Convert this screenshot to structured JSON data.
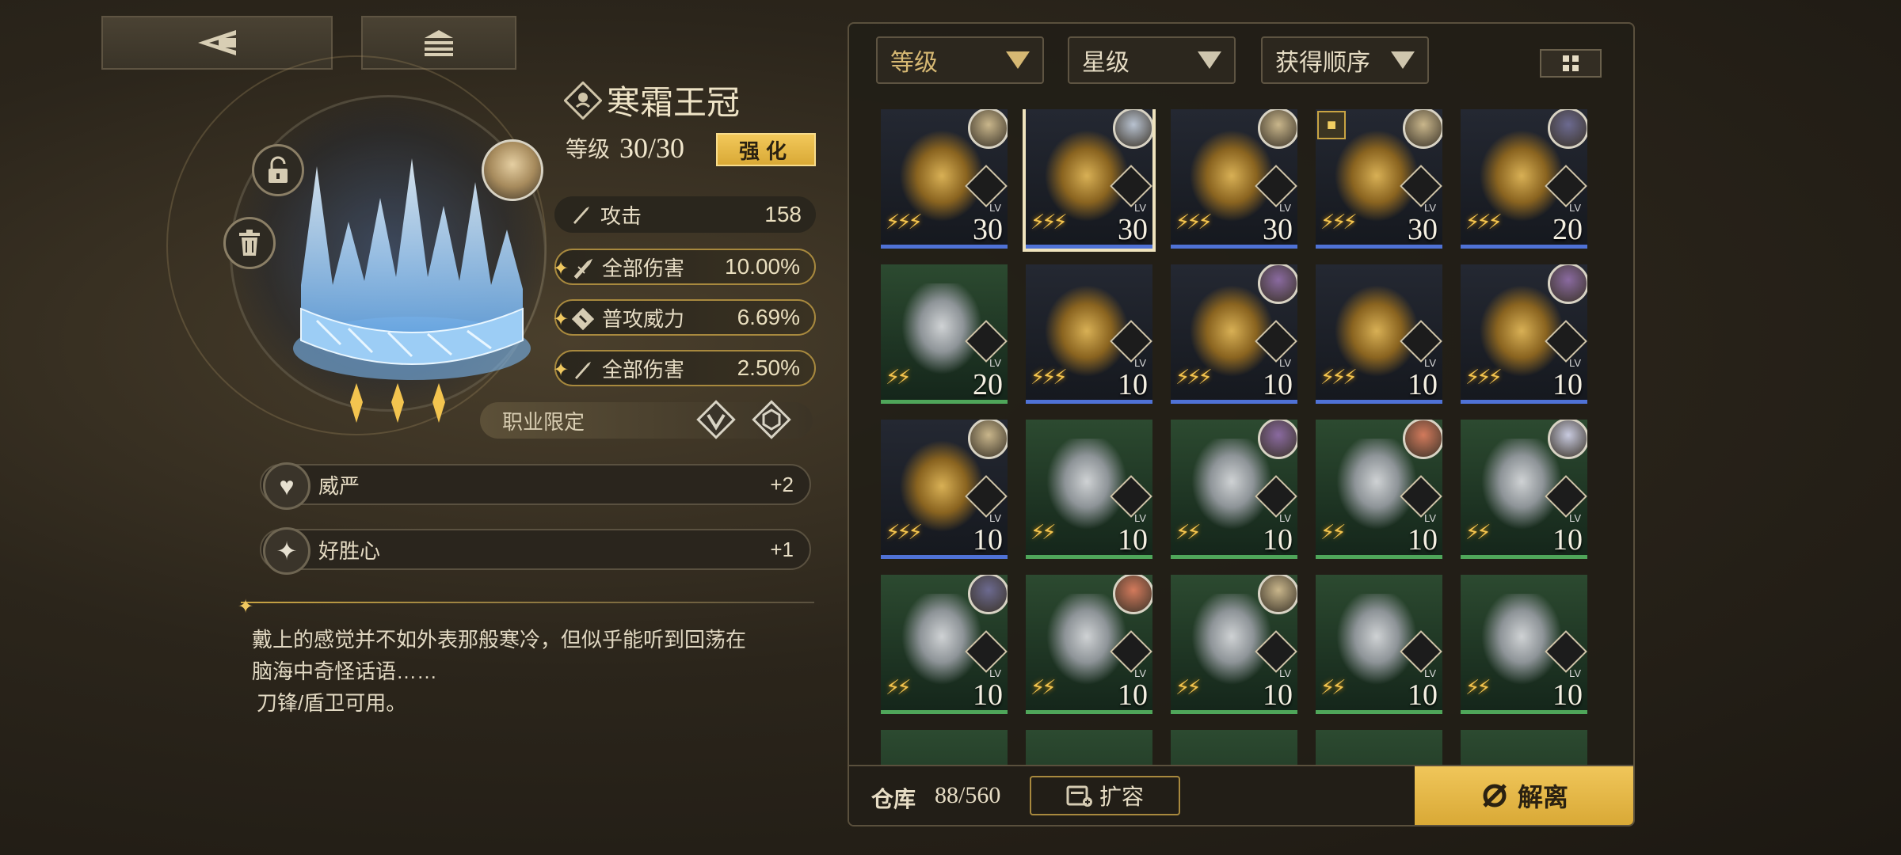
{
  "nav": {
    "back_icon": "back-triangle-icon",
    "home_icon": "home-stack-icon"
  },
  "item": {
    "name": "寒霜王冠",
    "level_label": "等级",
    "level_value": "30/30",
    "enhance_label": "强化",
    "main_stat": {
      "label": "攻击",
      "value": "158"
    },
    "sub_stats": [
      {
        "label": "全部伤害",
        "value": "10.00%"
      },
      {
        "label": "普攻威力",
        "value": "6.69%"
      },
      {
        "label": "全部伤害",
        "value": "2.50%"
      }
    ],
    "class_restrict_label": "职业限定",
    "traits": [
      {
        "label": "威严",
        "value": "+2"
      },
      {
        "label": "好胜心",
        "value": "+1"
      }
    ],
    "description_line1": "戴上的感觉并不如外表那般寒冷，但似乎能听到回荡在",
    "description_line2": "脑海中奇怪话语……",
    "description_line3": "刀锋/盾卫可用。",
    "rarity_stars": 3
  },
  "filters": {
    "level": "等级",
    "stars": "星级",
    "order": "获得顺序"
  },
  "inventory": {
    "cards": [
      {
        "level": "30",
        "lvtag": "LV",
        "stars": 3,
        "green": false
      },
      {
        "level": "30",
        "lvtag": "LV",
        "stars": 3,
        "green": false,
        "selected": true
      },
      {
        "level": "30",
        "lvtag": "LV",
        "stars": 3,
        "green": false
      },
      {
        "level": "30",
        "lvtag": "LV",
        "stars": 3,
        "green": false,
        "locked": true
      },
      {
        "level": "20",
        "lvtag": "LV",
        "stars": 3,
        "green": false
      },
      {
        "level": "20",
        "lvtag": "LV",
        "stars": 2,
        "green": true
      },
      {
        "level": "10",
        "lvtag": "LV",
        "stars": 3,
        "green": false
      },
      {
        "level": "10",
        "lvtag": "LV",
        "stars": 3,
        "green": false
      },
      {
        "level": "10",
        "lvtag": "LV",
        "stars": 3,
        "green": false
      },
      {
        "level": "10",
        "lvtag": "LV",
        "stars": 3,
        "green": false
      },
      {
        "level": "10",
        "lvtag": "LV",
        "stars": 3,
        "green": false
      },
      {
        "level": "10",
        "lvtag": "LV",
        "stars": 2,
        "green": true
      },
      {
        "level": "10",
        "lvtag": "LV",
        "stars": 2,
        "green": true
      },
      {
        "level": "10",
        "lvtag": "LV",
        "stars": 2,
        "green": true
      },
      {
        "level": "10",
        "lvtag": "LV",
        "stars": 2,
        "green": true
      },
      {
        "level": "10",
        "lvtag": "LV",
        "stars": 2,
        "green": true
      },
      {
        "level": "10",
        "lvtag": "LV",
        "stars": 2,
        "green": true
      },
      {
        "level": "10",
        "lvtag": "LV",
        "stars": 2,
        "green": true
      },
      {
        "level": "10",
        "lvtag": "LV",
        "stars": 2,
        "green": true
      },
      {
        "level": "10",
        "lvtag": "LV",
        "stars": 2,
        "green": true
      }
    ],
    "storage_label": "仓库",
    "storage_count": "88/560",
    "expand_label": "扩容",
    "dismantle_label": "解离"
  },
  "colors": {
    "gold": "#e8b94b",
    "blue_bar": "#4f72d6",
    "green_bar": "#4fa65a",
    "card_blue": "#1a1f29",
    "card_green": "#1f3825"
  }
}
